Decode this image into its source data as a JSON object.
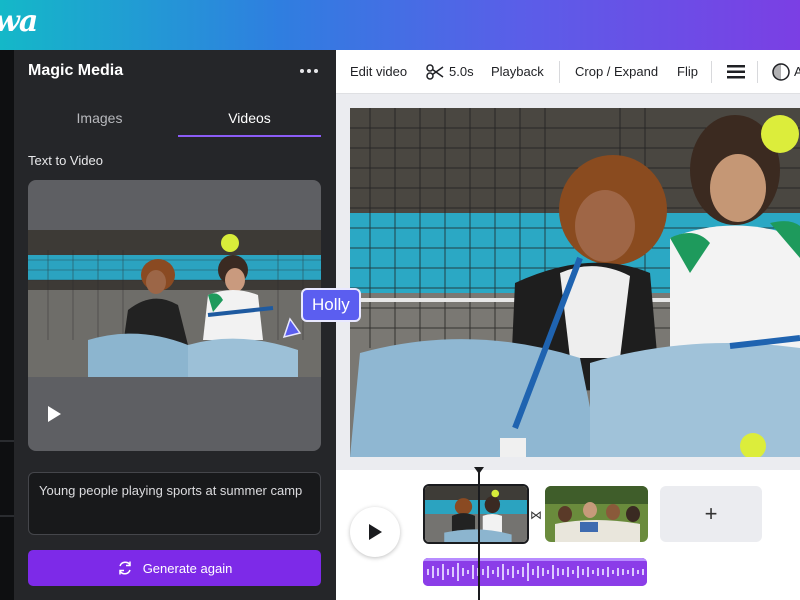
{
  "app": {
    "logo_text": "wa"
  },
  "panel": {
    "title": "Magic Media",
    "tabs": [
      {
        "label": "Images",
        "active": false
      },
      {
        "label": "Videos",
        "active": true
      }
    ],
    "section_label": "Text to Video",
    "prompt_text": "Young people playing sports at summer camp",
    "generate_label": "Generate again"
  },
  "collaborator": {
    "name": "Holly"
  },
  "toolbar": {
    "edit_video": "Edit video",
    "duration": "5.0s",
    "playback": "Playback",
    "crop_expand": "Crop / Expand",
    "flip": "Flip",
    "extra": "A"
  },
  "timeline": {
    "add_label": "+"
  },
  "colors": {
    "accent": "#7d2ae8",
    "collab": "#5b5ef0",
    "tab_indicator": "#8b5cf6"
  },
  "icons": [
    "scissors-icon",
    "menu-lines-icon",
    "transparency-icon",
    "play-icon",
    "transition-icon",
    "add-icon",
    "sync-icon",
    "more-icon"
  ]
}
